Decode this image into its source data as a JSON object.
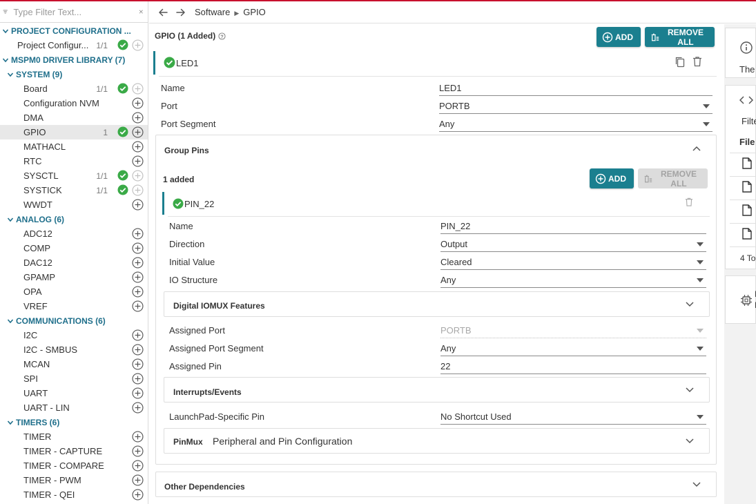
{
  "filter": {
    "placeholder": "Type Filter Text..."
  },
  "sidebar": {
    "project_configuration": {
      "label": "PROJECT CONFIGURATION ...",
      "item": {
        "label": "Project Configur...",
        "count": "1/1"
      }
    },
    "library": {
      "label": "MSPM0 DRIVER LIBRARY (7)"
    },
    "system": {
      "label": "SYSTEM (9)",
      "items": [
        {
          "label": "Board",
          "count": "1/1",
          "ok": true
        },
        {
          "label": "Configuration NVM",
          "count": "",
          "ok": false
        },
        {
          "label": "DMA",
          "count": "",
          "ok": false
        },
        {
          "label": "GPIO",
          "count": "1",
          "ok": true,
          "selected": true
        },
        {
          "label": "MATHACL",
          "count": "",
          "ok": false
        },
        {
          "label": "RTC",
          "count": "",
          "ok": false
        },
        {
          "label": "SYSCTL",
          "count": "1/1",
          "ok": true
        },
        {
          "label": "SYSTICK",
          "count": "1/1",
          "ok": true
        },
        {
          "label": "WWDT",
          "count": "",
          "ok": false
        }
      ]
    },
    "analog": {
      "label": "ANALOG (6)",
      "items": [
        "ADC12",
        "COMP",
        "DAC12",
        "GPAMP",
        "OPA",
        "VREF"
      ]
    },
    "communications": {
      "label": "COMMUNICATIONS (6)",
      "items": [
        "I2C",
        "I2C - SMBUS",
        "MCAN",
        "SPI",
        "UART",
        "UART - LIN"
      ]
    },
    "timers": {
      "label": "TIMERS (6)",
      "items": [
        "TIMER",
        "TIMER - CAPTURE",
        "TIMER - COMPARE",
        "TIMER - PWM",
        "TIMER - QEI"
      ]
    }
  },
  "breadcrumb": {
    "root": "Software",
    "current": "GPIO"
  },
  "main": {
    "title": "GPIO (1 Added)",
    "add_label": "ADD",
    "remove_all_label": "REMOVE ALL",
    "instance": "LED1",
    "fields": {
      "name_label": "Name",
      "name_value": "LED1",
      "port_label": "Port",
      "port_value": "PORTB",
      "segment_label": "Port Segment",
      "segment_value": "Any"
    },
    "group_pins": {
      "title": "Group Pins",
      "added": "1 added",
      "add_label": "ADD",
      "remove_all_label": "REMOVE ALL",
      "pin": "PIN_22",
      "fields": {
        "name_label": "Name",
        "name_value": "PIN_22",
        "direction_label": "Direction",
        "direction_value": "Output",
        "initial_label": "Initial Value",
        "initial_value": "Cleared",
        "io_label": "IO Structure",
        "io_value": "Any"
      },
      "iomux_title": "Digital IOMUX Features",
      "assigned": {
        "port_label": "Assigned Port",
        "port_value": "PORTB",
        "segment_label": "Assigned Port Segment",
        "segment_value": "Any",
        "pin_label": "Assigned Pin",
        "pin_value": "22"
      },
      "interrupts_title": "Interrupts/Events",
      "launchpad_label": "LaunchPad-Specific Pin",
      "launchpad_value": "No Shortcut Used",
      "pinmux_title": "PinMux",
      "pinmux_subtitle": "Peripheral and Pin Configuration"
    },
    "other_dependencies": "Other Dependencies"
  },
  "right_panel": {
    "info_text": "The",
    "filter_text": "Filte",
    "file_header": "File",
    "total_text": "4 To",
    "chip_text1": "M",
    "chip_text2": "L"
  },
  "colors": {
    "accent": "#1b7f8f",
    "ok_green": "#3aaa47",
    "category_blue": "#1f6f8b",
    "top_border": "#c8102e"
  }
}
